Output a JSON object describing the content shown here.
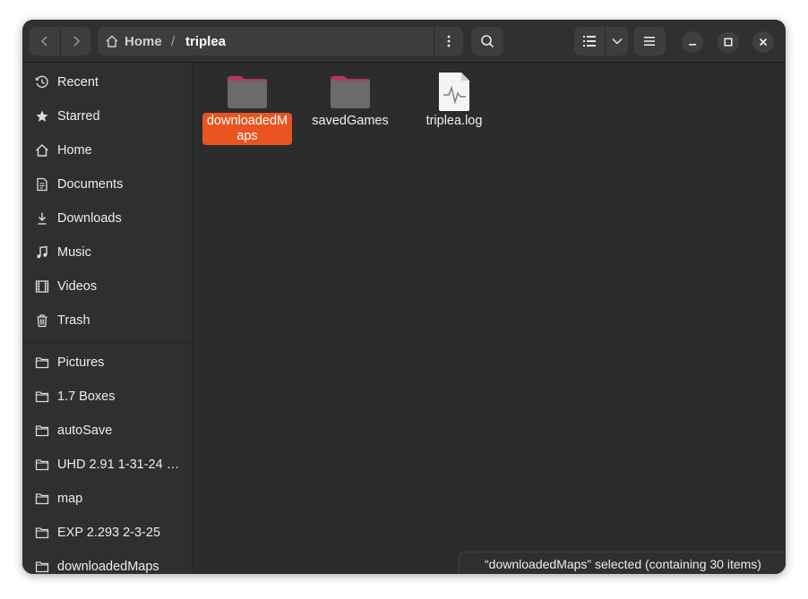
{
  "path": {
    "home_label": "Home",
    "separator": "/",
    "current": "triplea"
  },
  "header": {
    "back_icon": "chevron-left-icon",
    "forward_icon": "chevron-right-icon",
    "search_icon": "search-icon",
    "view_icon": "list-view-icon",
    "menu_icon": "hamburger-menu-icon"
  },
  "sidebar": {
    "items": [
      {
        "label": "Recent",
        "icon": "clock-icon"
      },
      {
        "label": "Starred",
        "icon": "star-icon"
      },
      {
        "label": "Home",
        "icon": "home-icon"
      },
      {
        "label": "Documents",
        "icon": "document-icon"
      },
      {
        "label": "Downloads",
        "icon": "download-icon"
      },
      {
        "label": "Music",
        "icon": "music-note-icon"
      },
      {
        "label": "Videos",
        "icon": "film-icon"
      },
      {
        "label": "Trash",
        "icon": "trash-icon"
      }
    ],
    "bookmarks": [
      {
        "label": "Pictures",
        "icon": "folder-icon"
      },
      {
        "label": "1.7 Boxes",
        "icon": "folder-icon"
      },
      {
        "label": "autoSave",
        "icon": "folder-icon"
      },
      {
        "label": "UHD 2.91 1-31-24 …",
        "icon": "folder-icon"
      },
      {
        "label": "map",
        "icon": "folder-icon"
      },
      {
        "label": "EXP 2.293 2-3-25",
        "icon": "folder-icon"
      },
      {
        "label": "downloadedMaps",
        "icon": "folder-icon"
      }
    ]
  },
  "files": [
    {
      "name": "downloadedMaps",
      "type": "folder",
      "selected": true
    },
    {
      "name": "savedGames",
      "type": "folder",
      "selected": false
    },
    {
      "name": "triplea.log",
      "type": "log-file",
      "selected": false
    }
  ],
  "status": {
    "text": "“downloadedMaps” selected  (containing 30 items)"
  },
  "colors": {
    "accent": "#e95420",
    "folder_tab": "#b5365b",
    "folder_body": "#6b6b6b"
  }
}
